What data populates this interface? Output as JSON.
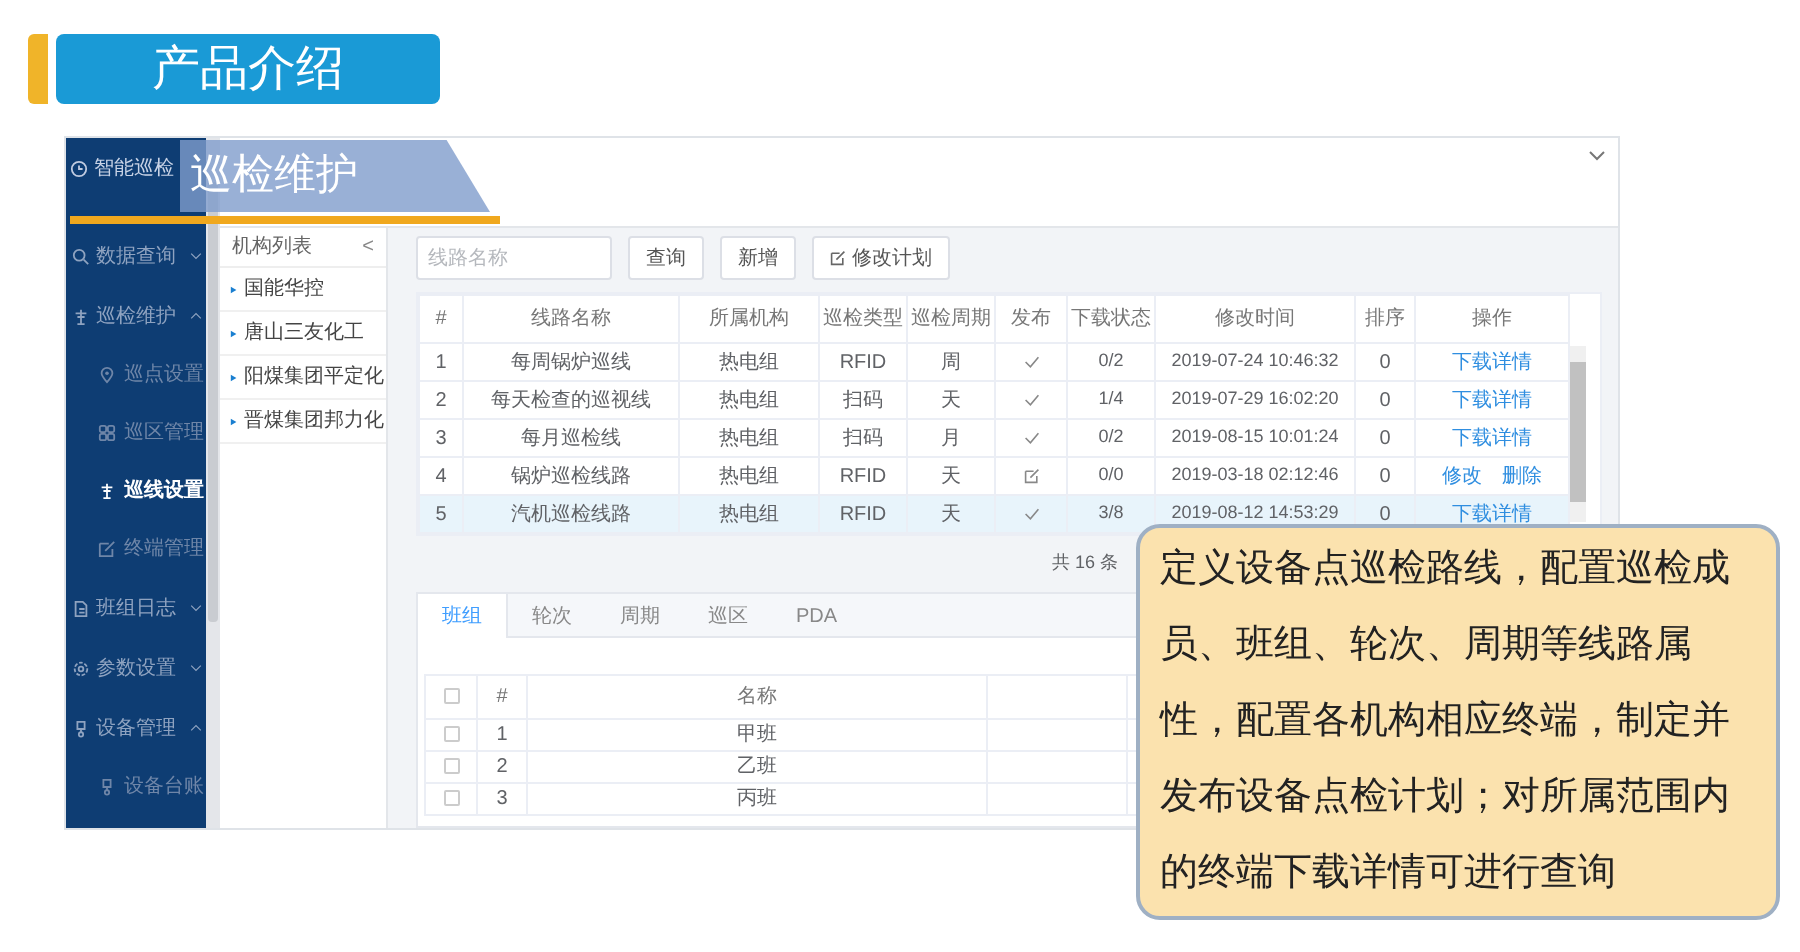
{
  "header": {
    "title": "产品介绍"
  },
  "banner": {
    "title": "巡检维护"
  },
  "sidebar": {
    "title": "智能巡检",
    "items": [
      {
        "label": "数据查询",
        "expanded": false
      },
      {
        "label": "巡检维护",
        "expanded": true,
        "children": [
          {
            "label": "巡点设置",
            "selected": false
          },
          {
            "label": "巡区管理",
            "selected": false
          },
          {
            "label": "巡线设置",
            "selected": true
          },
          {
            "label": "终端管理",
            "selected": false
          }
        ]
      },
      {
        "label": "班组日志",
        "expanded": false
      },
      {
        "label": "参数设置",
        "expanded": false
      },
      {
        "label": "设备管理",
        "expanded": true,
        "children": [
          {
            "label": "设备台账",
            "selected": false
          }
        ]
      }
    ]
  },
  "tree": {
    "title": "机构列表",
    "collapse": "<",
    "items": [
      "国能华控",
      "唐山三友化工",
      "阳煤集团平定化",
      "晋煤集团邦力化"
    ]
  },
  "toolbar": {
    "search": {
      "placeholder": "线路名称"
    },
    "buttons": [
      {
        "label": "查询",
        "icon": false
      },
      {
        "label": "新增",
        "icon": false
      },
      {
        "label": "修改计划",
        "icon": true
      }
    ]
  },
  "table": {
    "columns": [
      "#",
      "线路名称",
      "所属机构",
      "巡检类型",
      "巡检周期",
      "发布",
      "下载状态",
      "修改时间",
      "排序",
      "操作"
    ],
    "rows": [
      {
        "no": "1",
        "name": "每周锅炉巡线",
        "org": "热电组",
        "type": "RFID",
        "cycle": "周",
        "published": true,
        "download": "0/2",
        "time": "2019-07-24 10:46:32",
        "order": "0",
        "actions": [
          "下载详情"
        ],
        "selected": false
      },
      {
        "no": "2",
        "name": "每天检查的巡视线",
        "org": "热电组",
        "type": "扫码",
        "cycle": "天",
        "published": true,
        "download": "1/4",
        "time": "2019-07-29 16:02:20",
        "order": "0",
        "actions": [
          "下载详情"
        ],
        "selected": false
      },
      {
        "no": "3",
        "name": "每月巡检线",
        "org": "热电组",
        "type": "扫码",
        "cycle": "月",
        "published": true,
        "download": "0/2",
        "time": "2019-08-15 10:01:24",
        "order": "0",
        "actions": [
          "下载详情"
        ],
        "selected": false
      },
      {
        "no": "4",
        "name": "锅炉巡检线路",
        "org": "热电组",
        "type": "RFID",
        "cycle": "天",
        "published": false,
        "download": "0/0",
        "time": "2019-03-18 02:12:46",
        "order": "0",
        "actions": [
          "修改",
          "删除"
        ],
        "selected": false
      },
      {
        "no": "5",
        "name": "汽机巡检线路",
        "org": "热电组",
        "type": "RFID",
        "cycle": "天",
        "published": true,
        "download": "3/8",
        "time": "2019-08-12 14:53:29",
        "order": "0",
        "actions": [
          "下载详情"
        ],
        "selected": true
      }
    ]
  },
  "pagination": {
    "total": "共 16 条"
  },
  "detail_tabs": [
    {
      "label": "班组",
      "selected": true
    },
    {
      "label": "轮次",
      "selected": false
    },
    {
      "label": "周期",
      "selected": false
    },
    {
      "label": "巡区",
      "selected": false
    },
    {
      "label": "PDA",
      "selected": false
    }
  ],
  "detail_table": {
    "all_checked": false,
    "columns": [
      "#",
      "名称"
    ],
    "rows": [
      {
        "no": "1",
        "name": "甲班",
        "checked": false
      },
      {
        "no": "2",
        "name": "乙班",
        "checked": false
      },
      {
        "no": "3",
        "name": "丙班",
        "checked": false
      }
    ]
  },
  "callout": {
    "text": "定义设备点巡检路线，配置巡检成员、班组、轮次、周期等线路属性，配置各机构相应终端，制定并发布设备点检计划；对所属范围内的终端下载详情可进行查询"
  }
}
